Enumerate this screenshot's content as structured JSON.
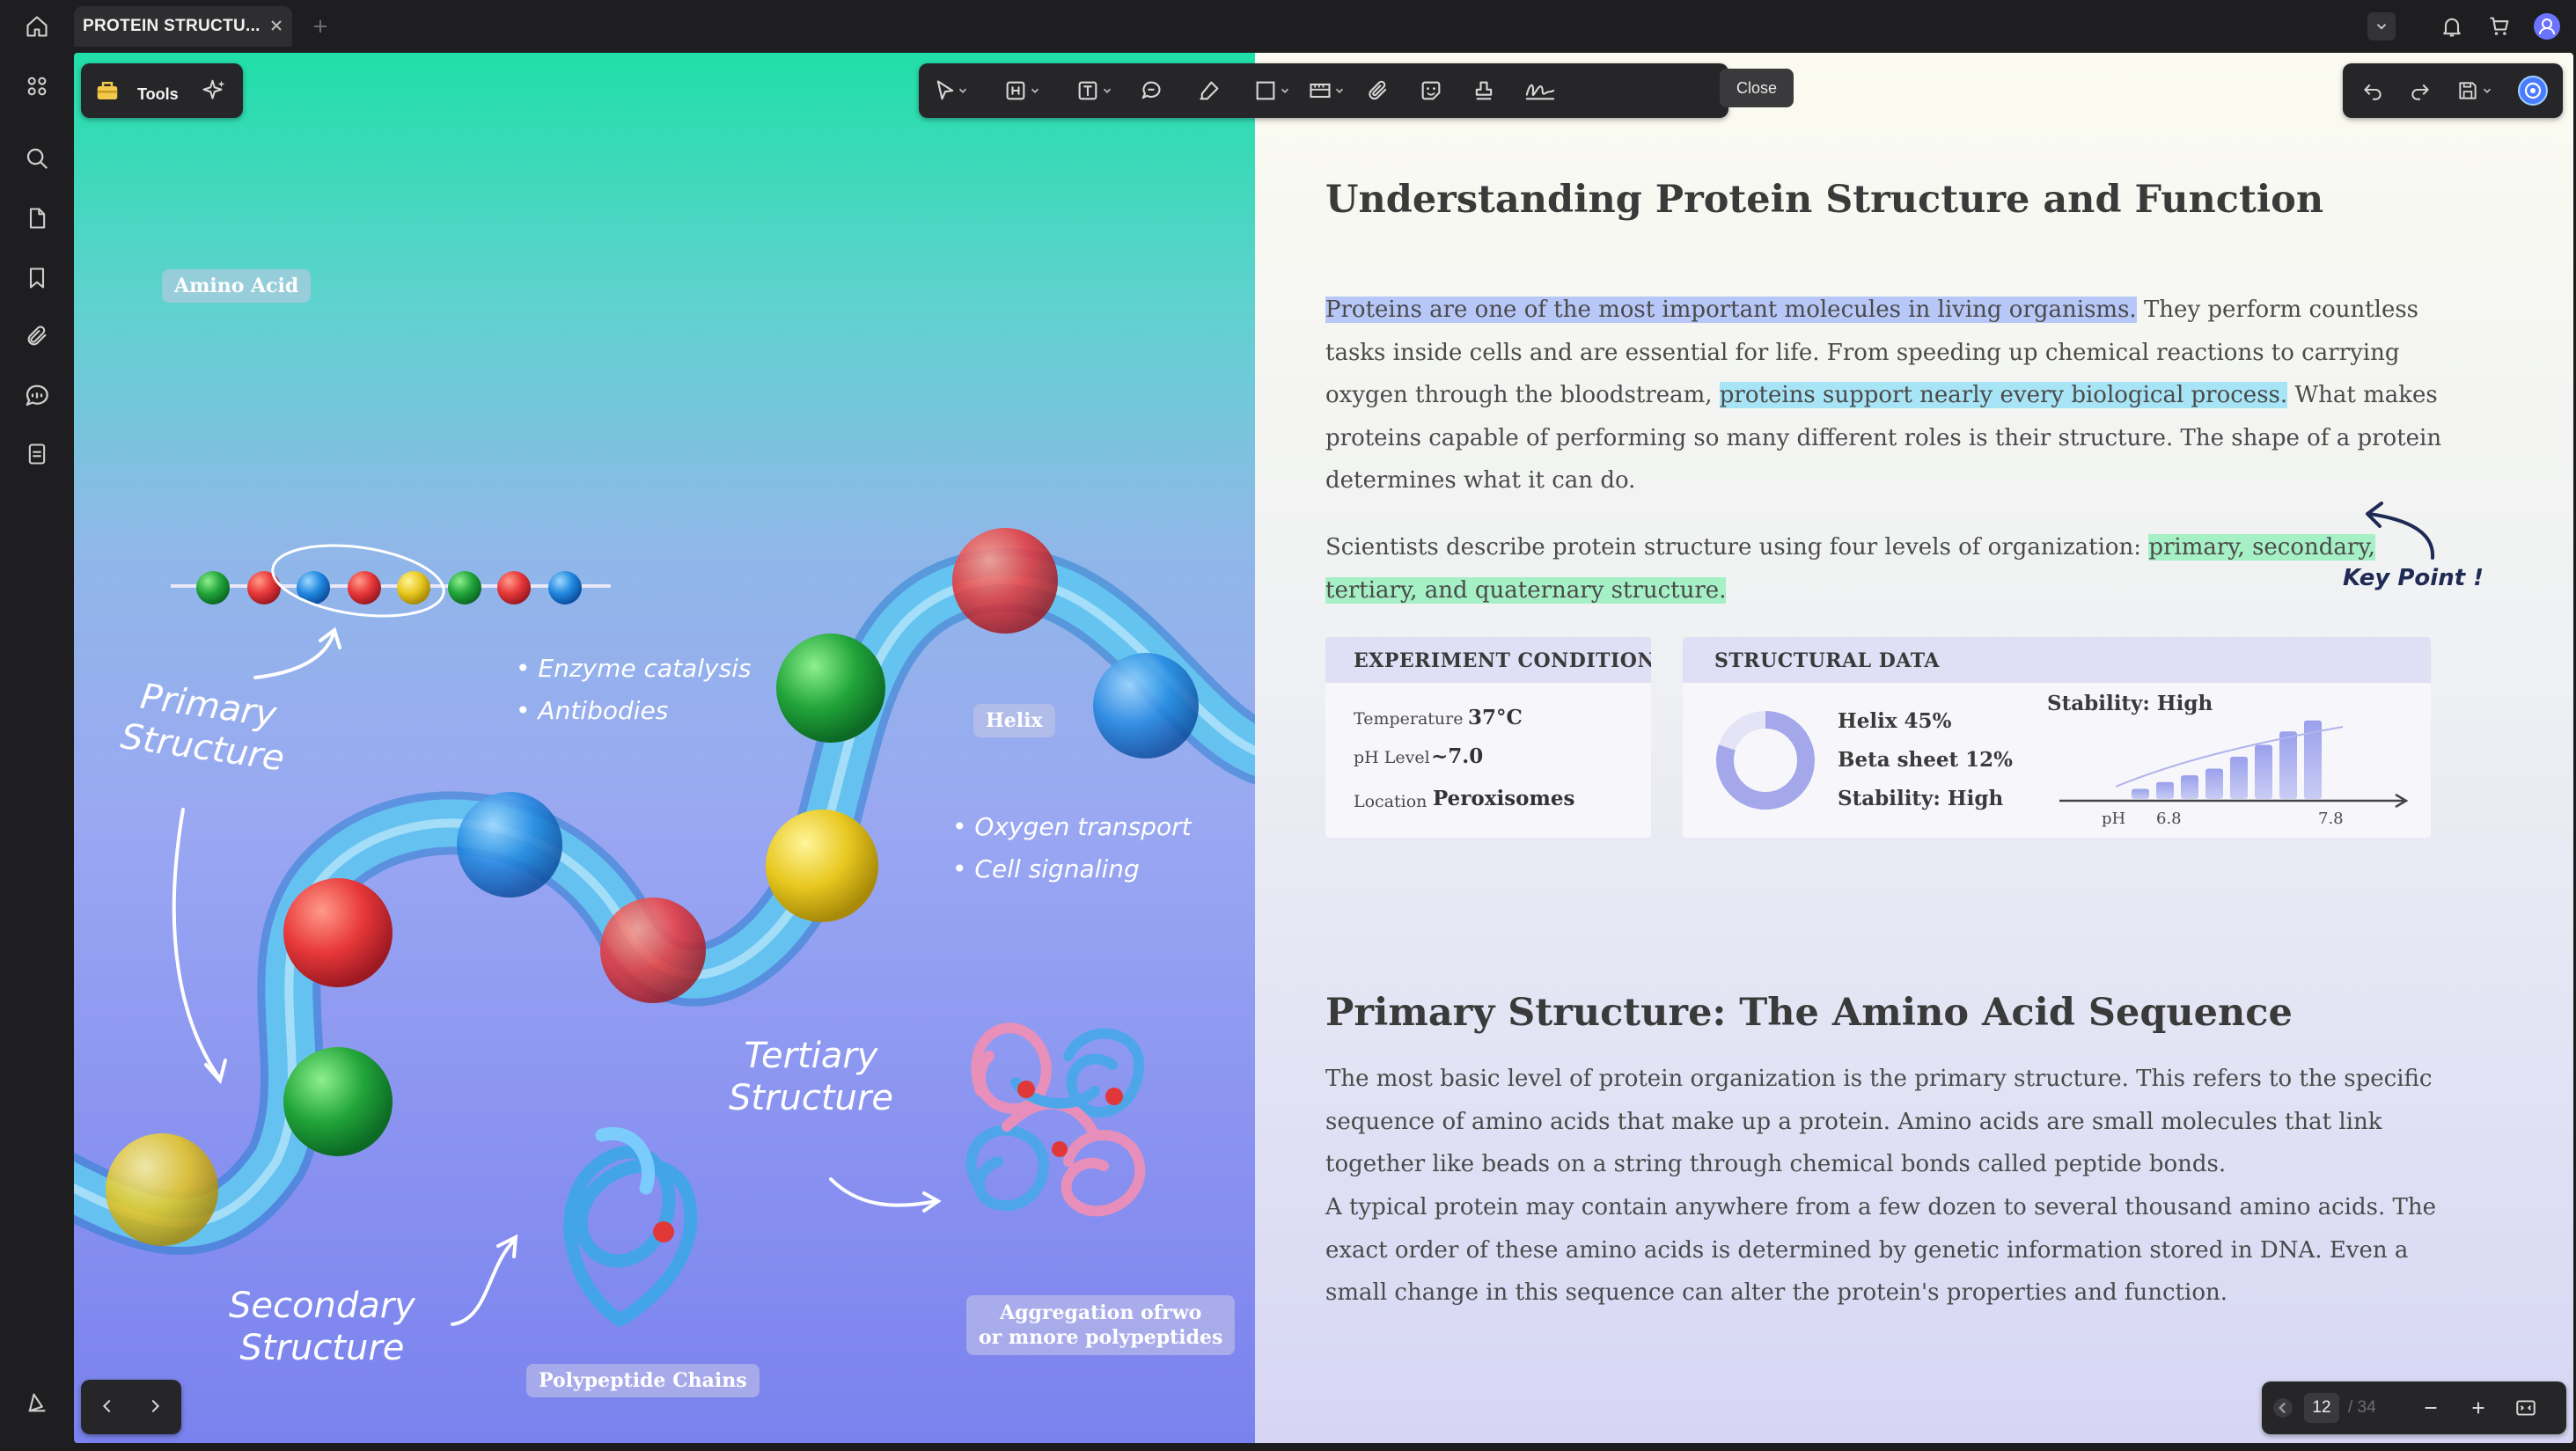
{
  "app": {
    "tab_title": "PROTEIN STRUCTU...",
    "colors": {
      "chrome": "#1e1e20",
      "toolbar": "#262629",
      "accent": "#5b8cff"
    }
  },
  "icons": {
    "titlebar_left": [
      "home-icon",
      "close-icon",
      "new-tab-icon"
    ],
    "titlebar_right": [
      "dropdown-icon",
      "bell-icon",
      "cart-icon",
      "profile-icon"
    ],
    "left_rail": [
      "apps-icon",
      "search-icon",
      "pages-icon",
      "bookmark-icon",
      "attachment-icon",
      "comment-icon",
      "scan-icon",
      "theme-icon"
    ]
  },
  "toolbar": {
    "tools_label": "Tools",
    "close_label": "Close",
    "tools": [
      "select",
      "text-box",
      "text",
      "comment",
      "highlighter",
      "shape",
      "measure",
      "attach",
      "sticker",
      "stamp",
      "signature"
    ]
  },
  "illustration": {
    "amino_acid_label": "Amino Acid",
    "helix_label": "Helix",
    "polypeptide_label": "Polypeptide Chains",
    "aggregation_label_1": "Aggregation ofrwo",
    "aggregation_label_2": "or mnore polypeptides",
    "primary_1": "Primary",
    "primary_2": "Structure",
    "secondary_1": "Secondary",
    "secondary_2": "Structure",
    "tertiary_1": "Tertiary",
    "tertiary_2": "Structure",
    "bullets_a": [
      "Enzyme catalysis",
      "Antibodies"
    ],
    "bullets_b": [
      "Oxygen transport",
      "Cell signaling"
    ]
  },
  "document": {
    "title": "Understanding Protein Structure and Function",
    "p1": {
      "hl1": "Proteins are one of the most important molecules in living organisms.",
      "t1": " They perform countless tasks inside cells and are essential for life. From speeding up chemical reactions to carrying oxygen through the bloodstream, ",
      "hl2": "proteins support nearly every biological process.",
      "t2": " What makes proteins capable of performing so many different roles is their structure. The shape of a protein determines what it can do."
    },
    "p2": {
      "t1": "Scientists describe protein structure using four levels of organization: ",
      "hl1": "primary, secondary,",
      "t2": " ",
      "hl2": "tertiary, and quaternary structure."
    },
    "key_point": "Key Point !",
    "experiment": {
      "header": "EXPERIMENT CONDITIONS",
      "temp_label": "Temperature",
      "temp_value": "37°C",
      "ph_label": "pH Level",
      "ph_value": "~7.0",
      "loc_label": "Location",
      "loc_value": "Peroxisomes"
    },
    "structural": {
      "header": "STRUCTURAL DATA",
      "helix": "Helix 45%",
      "beta": "Beta sheet 12%",
      "stability": "Stability: High",
      "chart_title": "Stability: High",
      "axis_label": "pH",
      "tick1": "6.8",
      "tick2": "7.8",
      "bar_levels": [
        0.12,
        0.2,
        0.28,
        0.36,
        0.5,
        0.64,
        0.8,
        0.93
      ],
      "donut_fraction": 0.8
    },
    "h2": "Primary Structure: The Amino Acid Sequence",
    "p3": "The most basic level of protein organization is the primary structure. This refers to the specific sequence of amino acids that make up a protein. Amino acids are small molecules that link together like beads on a string through chemical bonds called peptide bonds.",
    "p4": "A typical protein may contain anywhere from a few dozen to several thousand amino acids. The exact order of these amino acids is determined by genetic information stored in DNA. Even a small change in this sequence can alter the protein's properties and function."
  },
  "pager": {
    "current": "12",
    "total": "/ 34"
  }
}
